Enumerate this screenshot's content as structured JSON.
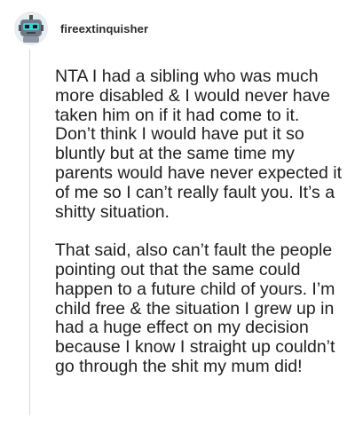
{
  "post": {
    "username": "fireextinquisher",
    "avatar_icon": "robot-avatar-icon",
    "paragraphs": [
      "NTA I had a sibling who was much more disabled & I would never have taken him on if it had come to it. Don’t think I would have put it so bluntly but at the same time my parents would have never expected it of me so I can’t really fault you. It’s a shitty situation.",
      "That said, also can’t fault the people pointing out that the same could happen to a future child of yours. I’m child free & the situation I grew up in had a huge effect on my decision because I know I straight up couldn’t go through the shit my mum did!"
    ]
  },
  "colors": {
    "background": "#ffffff",
    "text": "#1f1f1f",
    "thread_line": "#d7d7d7",
    "avatar_accent": "#3fd0d6"
  }
}
